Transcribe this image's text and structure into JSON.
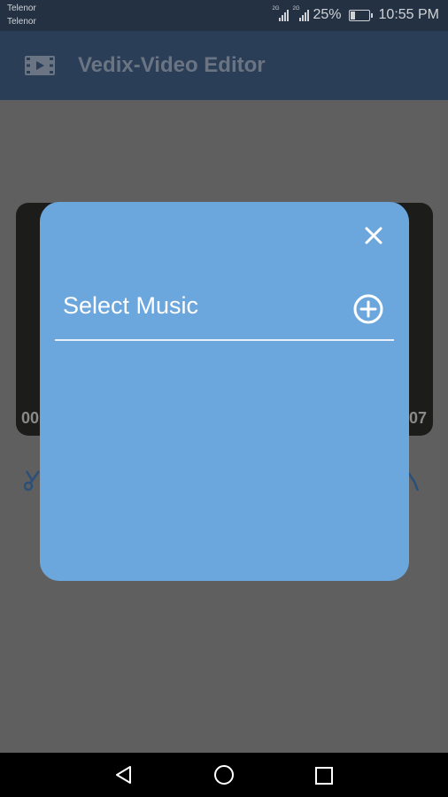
{
  "status_bar": {
    "carrier_1": "Telenor",
    "carrier_2": "Telenor",
    "network_1": "2G",
    "network_2": "2G",
    "battery": "25%",
    "time": "10:55 PM"
  },
  "app_bar": {
    "title": "Vedix-Video Editor",
    "icon": "video-film-icon"
  },
  "background": {
    "time_start": "00",
    "time_end": "07"
  },
  "dialog": {
    "title": "Select Music",
    "close_icon": "close-icon",
    "add_icon": "add-circle-icon",
    "background_color": "#6ba7dc"
  },
  "nav_bar": {
    "back_icon": "back-triangle-icon",
    "home_icon": "home-circle-icon",
    "recent_icon": "recent-square-icon"
  },
  "colors": {
    "status_bar": "#243142",
    "app_bar": "#2b3e58",
    "overlay": "#5f5f5f"
  }
}
